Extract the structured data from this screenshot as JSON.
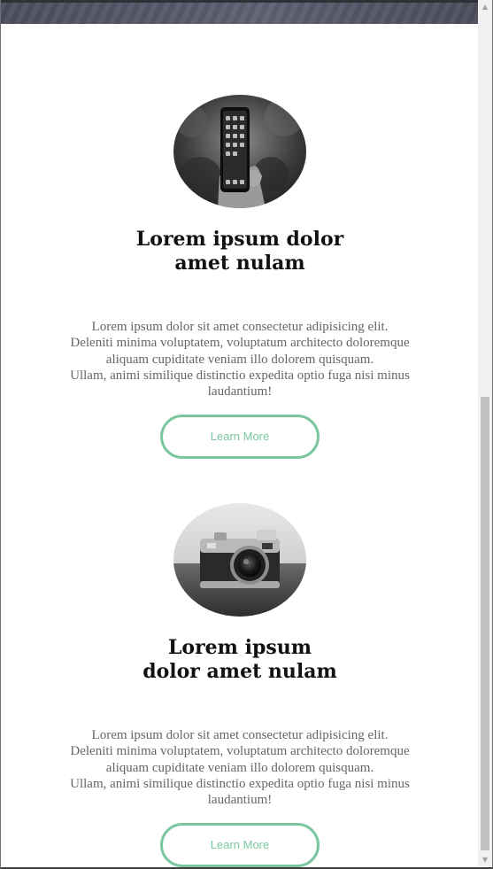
{
  "cards": [
    {
      "image_icon": "smartphone-photo",
      "title_lines": [
        "Lorem ipsum dolor",
        "amet nulam"
      ],
      "text_lines": [
        "Lorem ipsum dolor sit amet consectetur adipisicing elit.",
        "Deleniti minima voluptatem, voluptatum architecto doloremque",
        "aliquam cupiditate veniam illo dolorem quisquam.",
        "Ullam, animi similique distinctio expedita optio fuga nisi minus",
        "laudantium!"
      ],
      "button_label": "Learn More"
    },
    {
      "image_icon": "camera-photo",
      "title_lines": [
        "Lorem ipsum",
        "dolor amet nulam"
      ],
      "text_lines": [
        "Lorem ipsum dolor sit amet consectetur adipisicing elit.",
        "Deleniti minima voluptatem, voluptatum architecto doloremque",
        "aliquam cupiditate veniam illo dolorem quisquam.",
        "Ullam, animi similique distinctio expedita optio fuga nisi minus",
        "laudantium!"
      ],
      "button_label": "Learn More"
    }
  ],
  "scrollbar": {
    "up_arrow": "▲",
    "down_arrow": "▼"
  },
  "colors": {
    "accent": "#7ac79f",
    "heading": "#111111",
    "body_text": "#666666",
    "background": "#ffffff"
  }
}
